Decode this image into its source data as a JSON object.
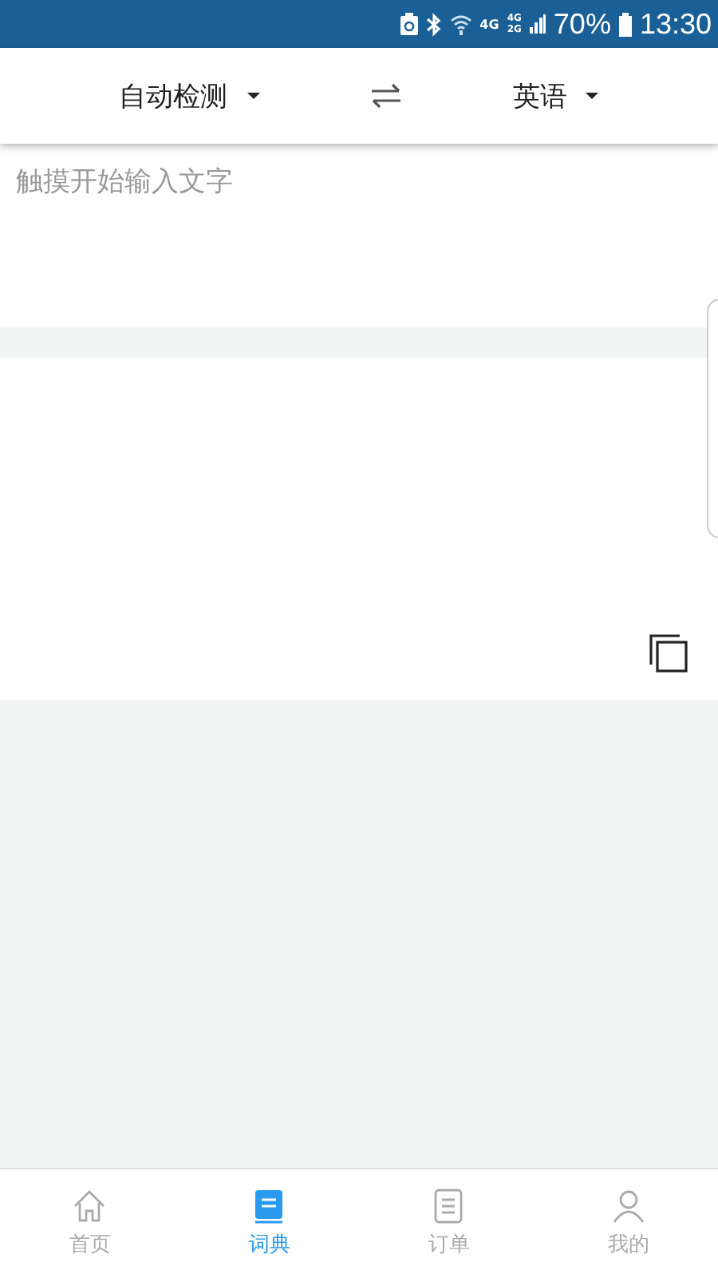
{
  "status_bar": {
    "network_1": "4G",
    "network_2_top": "4G",
    "network_2_bottom": "2G",
    "battery": "70%",
    "time": "13:30"
  },
  "languages": {
    "source": "自动检测",
    "target": "英语"
  },
  "input": {
    "placeholder": "触摸开始输入文字"
  },
  "tabs": [
    {
      "label": "首页",
      "kind": "home",
      "selected": false
    },
    {
      "label": "词典",
      "kind": "book",
      "selected": true
    },
    {
      "label": "订单",
      "kind": "list",
      "selected": false
    },
    {
      "label": "我的",
      "kind": "person",
      "selected": false
    }
  ]
}
